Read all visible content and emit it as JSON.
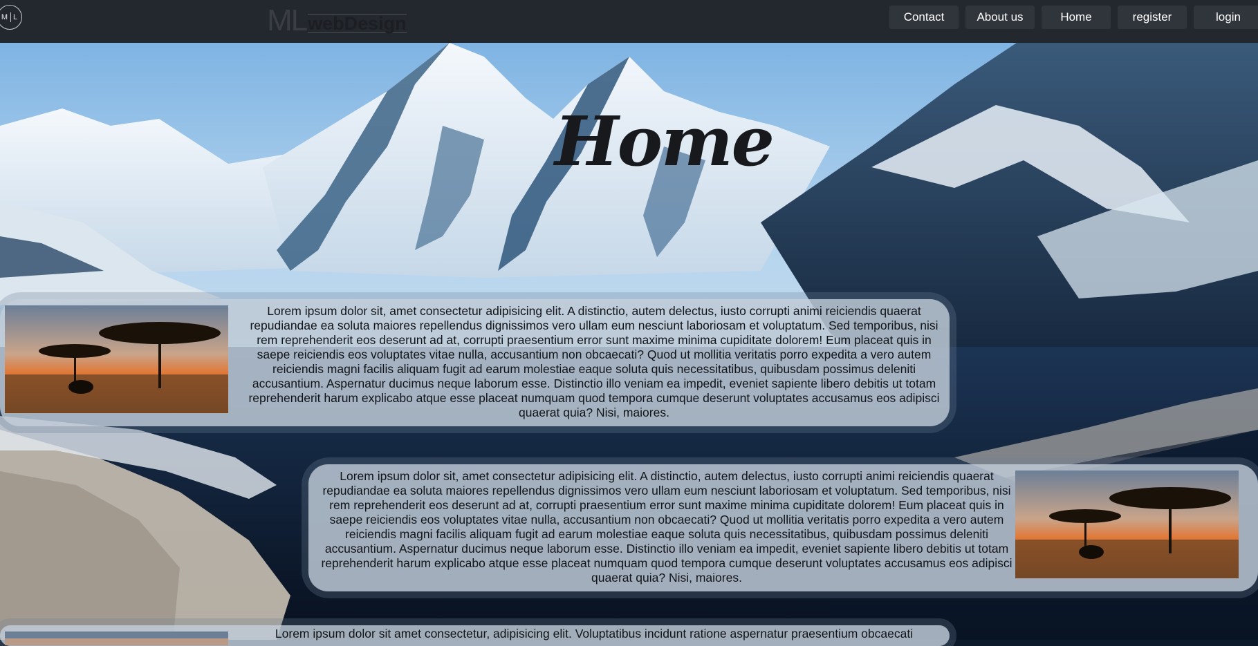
{
  "brand": {
    "circle_left": "M",
    "circle_right": "L",
    "logo_ml": "ML",
    "logo_name": "webDesign"
  },
  "nav": {
    "items": [
      {
        "label": "Contact"
      },
      {
        "label": "About us"
      },
      {
        "label": "Home"
      },
      {
        "label": "register"
      },
      {
        "label": "login"
      }
    ]
  },
  "hero": {
    "title": "Home"
  },
  "sections": [
    {
      "image": "savanna-acacia-elephant-sunset",
      "text": "Lorem ipsum dolor sit, amet consectetur adipisicing elit. A distinctio, autem delectus, iusto corrupti animi reiciendis quaerat repudiandae ea soluta maiores repellendus dignissimos vero ullam eum nesciunt laboriosam et voluptatum. Sed temporibus, nisi rem reprehenderit eos deserunt ad at, corrupti praesentium error sunt maxime minima cupiditate dolorem! Eum placeat quis in saepe reiciendis eos voluptates vitae nulla, accusantium non obcaecati? Quod ut mollitia veritatis porro expedita a vero autem reiciendis magni facilis aliquam fugit ad earum molestiae eaque soluta quis necessitatibus, quibusdam possimus deleniti accusantium. Aspernatur ducimus neque laborum esse. Distinctio illo veniam ea impedit, eveniet sapiente libero debitis ut totam reprehenderit harum explicabo atque esse placeat numquam quod tempora cumque deserunt voluptates accusamus eos adipisci quaerat quia? Nisi, maiores."
    },
    {
      "image": "savanna-acacia-elephant-sunset",
      "text": "Lorem ipsum dolor sit, amet consectetur adipisicing elit. A distinctio, autem delectus, iusto corrupti animi reiciendis quaerat repudiandae ea soluta maiores repellendus dignissimos vero ullam eum nesciunt laboriosam et voluptatum. Sed temporibus, nisi rem reprehenderit eos deserunt ad at, corrupti praesentium error sunt maxime minima cupiditate dolorem! Eum placeat quis in saepe reiciendis eos voluptates vitae nulla, accusantium non obcaecati? Quod ut mollitia veritatis porro expedita a vero autem reiciendis magni facilis aliquam fugit ad earum molestiae eaque soluta quis necessitatibus, quibusdam possimus deleniti accusantium. Aspernatur ducimus neque laborum esse. Distinctio illo veniam ea impedit, eveniet sapiente libero debitis ut totam reprehenderit harum explicabo atque esse placeat numquam quod tempora cumque deserunt voluptates accusamus eos adipisci quaerat quia? Nisi, maiores."
    },
    {
      "image": "savanna-acacia-elephant-sunset",
      "text": "Lorem ipsum dolor sit amet consectetur, adipisicing elit. Voluptatibus incidunt ratione aspernatur praesentium obcaecati"
    }
  ]
}
